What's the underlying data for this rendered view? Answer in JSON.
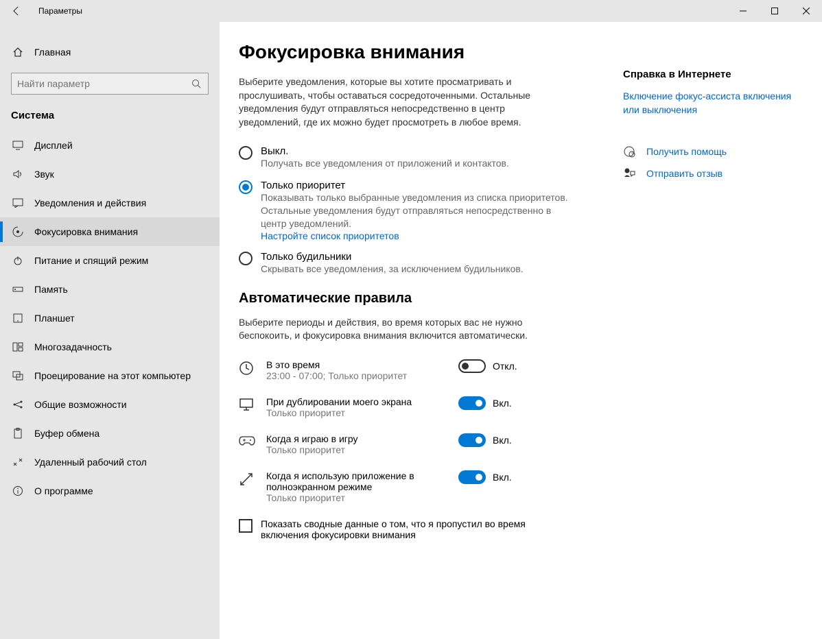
{
  "window": {
    "title": "Параметры"
  },
  "sidebar": {
    "home": "Главная",
    "search_placeholder": "Найти параметр",
    "category": "Система",
    "items": [
      {
        "label": "Дисплей"
      },
      {
        "label": "Звук"
      },
      {
        "label": "Уведомления и действия"
      },
      {
        "label": "Фокусировка внимания"
      },
      {
        "label": "Питание и спящий режим"
      },
      {
        "label": "Память"
      },
      {
        "label": "Планшет"
      },
      {
        "label": "Многозадачность"
      },
      {
        "label": "Проецирование на этот компьютер"
      },
      {
        "label": "Общие возможности"
      },
      {
        "label": "Буфер обмена"
      },
      {
        "label": "Удаленный рабочий стол"
      },
      {
        "label": "О программе"
      }
    ]
  },
  "page": {
    "title": "Фокусировка внимания",
    "intro": "Выберите уведомления, которые вы хотите просматривать и прослушивать, чтобы оставаться сосредоточенными. Остальные уведомления будут отправляться непосредственно в центр уведомлений, где их можно будет просмотреть в любое время.",
    "radios": {
      "off": {
        "label": "Выкл.",
        "desc": "Получать все уведомления от приложений и контактов."
      },
      "priority": {
        "label": "Только приоритет",
        "desc": "Показывать только выбранные уведомления из списка приоритетов. Остальные уведомления будут отправляться непосредственно в центр уведомлений.",
        "link": "Настройте список приоритетов"
      },
      "alarms": {
        "label": "Только будильники",
        "desc": "Скрывать все уведомления, за исключением будильников."
      }
    },
    "rules_heading": "Автоматические правила",
    "rules_intro": "Выберите периоды и действия, во время которых вас не нужно беспокоить, и фокусировка внимания включится автоматически.",
    "rules": [
      {
        "title": "В это время",
        "sub": "23:00 - 07:00; Только приоритет",
        "state": "Откл.",
        "on": false
      },
      {
        "title": "При дублировании моего экрана",
        "sub": "Только приоритет",
        "state": "Вкл.",
        "on": true
      },
      {
        "title": "Когда я играю в игру",
        "sub": "Только приоритет",
        "state": "Вкл.",
        "on": true
      },
      {
        "title": "Когда я использую приложение в полноэкранном режиме",
        "sub": "Только приоритет",
        "state": "Вкл.",
        "on": true
      }
    ],
    "summary_checkbox": "Показать сводные данные о том, что я пропустил во время включения фокусировки внимания"
  },
  "aside": {
    "help_heading": "Справка в Интернете",
    "help_link": "Включение фокус-ассиста включения или выключения",
    "get_help": "Получить помощь",
    "feedback": "Отправить отзыв"
  }
}
